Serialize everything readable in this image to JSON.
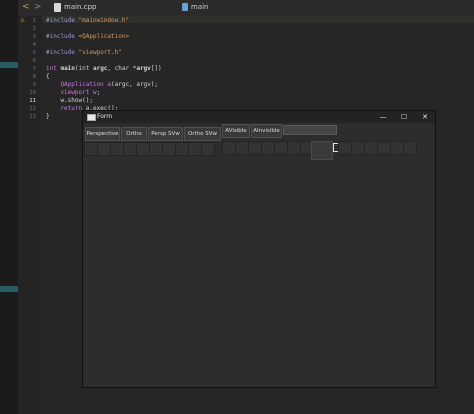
{
  "tabs": {
    "back_glyph": "<",
    "forward_glyph": ">",
    "file_name": "main.cpp",
    "symbol_name": "main"
  },
  "line_numbers": [
    "1",
    "2",
    "3",
    "4",
    "5",
    "6",
    "7",
    "8",
    "9",
    "10",
    "11",
    "12",
    "13"
  ],
  "code": {
    "l1a": "#include ",
    "l1b": "\"mainwindow.h\"",
    "l3a": "#include ",
    "l3b": "<QApplication>",
    "l5a": "#include ",
    "l5b": "\"viewport.h\"",
    "l7a": "int ",
    "l7b": "main",
    "l7c": "(int ",
    "l7d": "argc",
    "l7e": ", char *",
    "l7f": "argv",
    "l7g": "[])",
    "l8": "{",
    "l9a": "    QApplication ",
    "l9b": "a",
    "l9c": "(argc, argv);",
    "l10a": "    viewport ",
    "l10b": "w",
    "l10c": ";",
    "l11": "    w.show();",
    "l12a": "    return ",
    "l12b": "a.exec();",
    "l13": "}"
  },
  "form": {
    "title": "Form",
    "min_glyph": "—",
    "max_glyph": "☐",
    "close_glyph": "✕",
    "buttons": [
      "Perspective",
      "Ortho",
      "Persp SVw",
      "Ortho SVw",
      "AVisible",
      "AInvisible"
    ]
  },
  "icons": {
    "warning": "warning-icon",
    "file": "file-icon",
    "symbol": "symbol-icon",
    "window": "window-icon",
    "cursor": "text-cursor-icon"
  },
  "colors": {
    "ide_background": "#262626",
    "accent_marker": "#2a5a66",
    "warning": "#e0b020",
    "form_background": "#2d2d2d"
  }
}
